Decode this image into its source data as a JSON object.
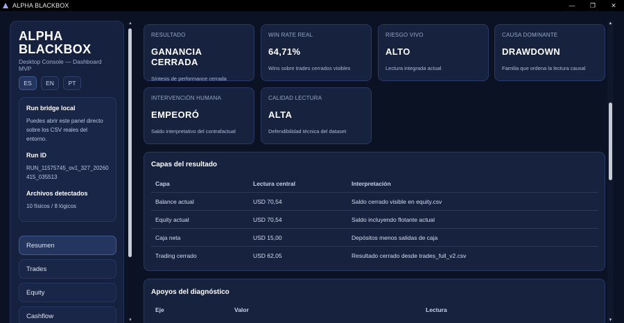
{
  "window": {
    "title": "ALPHA BLACKBOX",
    "minimize": "—",
    "restore": "❐",
    "close": "✕"
  },
  "sidebar": {
    "brand": "ALPHA BLACKBOX",
    "subtitle": "Desktop Console — Dashboard MVP",
    "languages": [
      "ES",
      "EN",
      "PT"
    ],
    "active_language": "ES",
    "run_bridge_title": "Run bridge local",
    "run_bridge_text": "Puedes abrir este panel directo sobre los CSV reales del entorno.",
    "run_id_title": "Run ID",
    "run_id_value": "RUN_11575745_ov1_327_20260415_035513",
    "files_title": "Archivos detectados",
    "files_value": "10 físicos / 8 lógicos",
    "nav": [
      "Resumen",
      "Trades",
      "Equity",
      "Cashflow"
    ],
    "active_nav": "Resumen"
  },
  "cards": [
    {
      "label": "RESULTADO",
      "value": "GANANCIA CERRADA",
      "desc": "Síntesis de performance cerrada"
    },
    {
      "label": "WIN RATE REAL",
      "value": "64,71%",
      "desc": "Wins sobre trades cerrados visibles"
    },
    {
      "label": "RIESGO VIVO",
      "value": "ALTO",
      "desc": "Lectura integrada actual"
    },
    {
      "label": "CAUSA DOMINANTE",
      "value": "DRAWDOWN",
      "desc": "Familia que ordena la lectura causal"
    },
    {
      "label": "INTERVENCIÓN HUMANA",
      "value": "EMPEORÓ",
      "desc": "Saldo interpretativo del contrafactual"
    },
    {
      "label": "CALIDAD LECTURA",
      "value": "ALTA",
      "desc": "Defendibilidad técnica del dataset"
    }
  ],
  "capas": {
    "title": "Capas del resultado",
    "headers": [
      "Capa",
      "Lectura central",
      "Interpretación"
    ],
    "rows": [
      [
        "Balance actual",
        "USD 70,54",
        "Saldo cerrado visible en equity.csv"
      ],
      [
        "Equity actual",
        "USD 70,54",
        "Saldo incluyendo flotante actual"
      ],
      [
        "Caja neta",
        "USD 15,00",
        "Depósitos menos salidas de caja"
      ],
      [
        "Trading cerrado",
        "USD 62,05",
        "Resultado cerrado desde trades_full_v2.csv"
      ]
    ]
  },
  "apoyos": {
    "title": "Apoyos del diagnóstico",
    "headers": [
      "Eje",
      "Valor",
      "Lectura"
    ]
  },
  "icons": {
    "app": "app-logo-icon"
  },
  "colors": {
    "background": "#0b1224",
    "card": "#17223f",
    "border": "#2a3966",
    "active": "#24365f"
  }
}
